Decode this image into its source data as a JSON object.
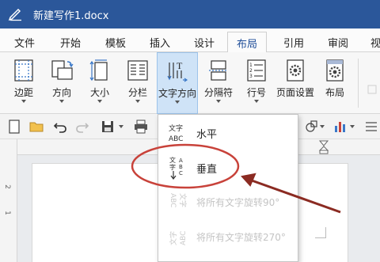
{
  "window": {
    "title": "新建写作1.docx"
  },
  "tabs": [
    {
      "label": "文件"
    },
    {
      "label": "开始"
    },
    {
      "label": "模板"
    },
    {
      "label": "插入"
    },
    {
      "label": "设计"
    },
    {
      "label": "布局"
    },
    {
      "label": "引用"
    },
    {
      "label": "审阅"
    },
    {
      "label": "视"
    }
  ],
  "ribbon": {
    "margins": "边距",
    "orientation": "方向",
    "size": "大小",
    "columns": "分栏",
    "text_direction": "文字方向",
    "breaks": "分隔符",
    "line_numbers": "行号",
    "page_setup": "页面设置",
    "layout": "布局"
  },
  "ruler": {
    "ticks": [
      "2",
      "1"
    ]
  },
  "text_direction_menu": {
    "items": [
      {
        "label": "水平",
        "enabled": true
      },
      {
        "label": "垂直",
        "enabled": true
      },
      {
        "label": "将所有文字旋转90°",
        "enabled": false
      },
      {
        "label": "将所有文字旋转270°",
        "enabled": false
      }
    ],
    "icon_text": {
      "hz": "文字",
      "abc": "ABC"
    }
  },
  "colors": {
    "titlebar": "#2b579a",
    "accent": "#1f4e99",
    "highlight_circle": "#c8423a",
    "arrow": "#8b2b22"
  }
}
